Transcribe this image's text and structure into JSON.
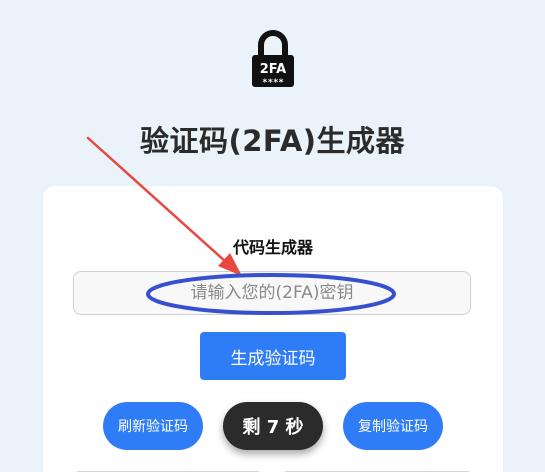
{
  "logo": {
    "badge_text": "2FA",
    "stars_text": "****",
    "icon": "padlock-icon"
  },
  "header": {
    "title": "验证码(2FA)生成器"
  },
  "card": {
    "title": "代码生成器",
    "secret_input": {
      "value": "",
      "placeholder": "请输入您的(2FA)密钥"
    },
    "generate_label": "生成验证码",
    "refresh_label": "刷新验证码",
    "countdown_label": "剩 7 秒",
    "copy_label": "复制验证码"
  },
  "colors": {
    "background": "#e9f3f9",
    "primary": "#2f7df6",
    "countdown": "#2b2b2b",
    "annotation_arrow": "#e8483f",
    "annotation_circle": "#3650d0"
  }
}
